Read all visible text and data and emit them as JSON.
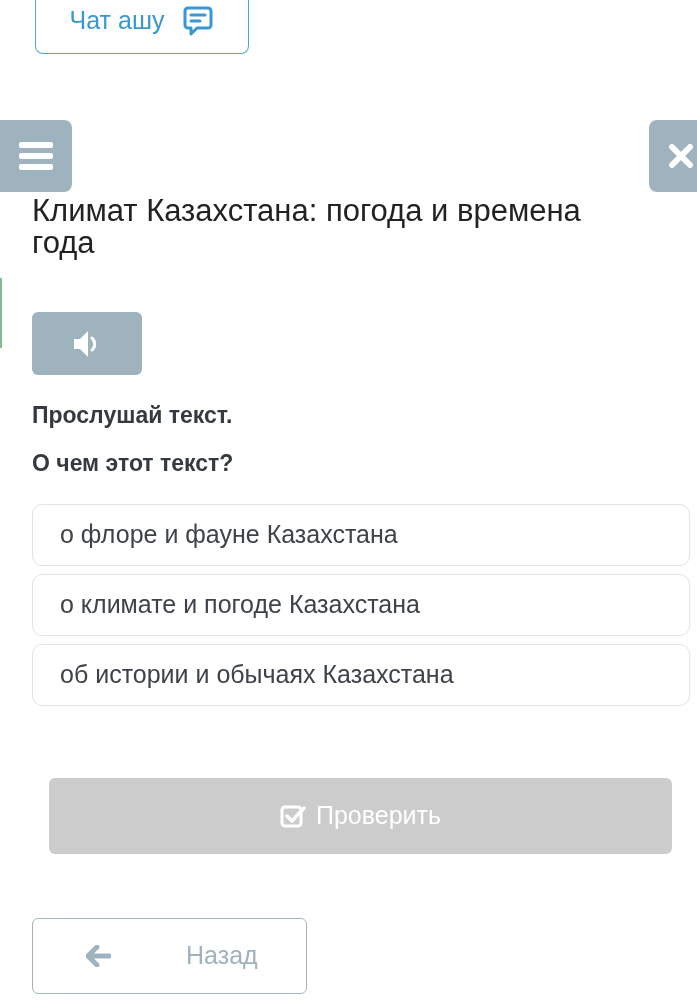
{
  "chat_button": {
    "label": "Чат ашу"
  },
  "title": "Климат Казахстана: погода и времена года",
  "instruction": "Прослушай текст.",
  "question": "О чем этот текст?",
  "options": [
    {
      "label": "о флоре и фауне Казахстана",
      "selected": false
    },
    {
      "label": "о климате и погоде Казахстана",
      "selected": false
    },
    {
      "label": "об истории и обычаях Казахстана",
      "selected": false
    }
  ],
  "check_button": {
    "label": "Проверить",
    "disabled": true
  },
  "back_button": {
    "label": "Назад"
  }
}
